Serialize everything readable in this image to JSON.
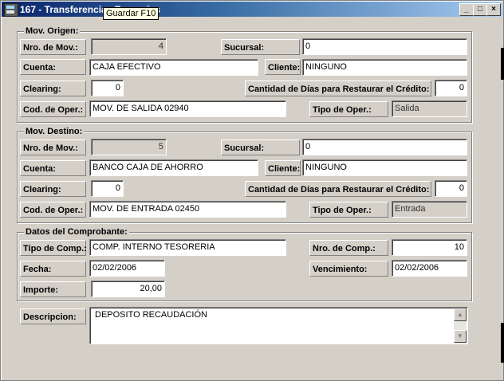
{
  "window": {
    "title": "167 - Transferencias Bancarias"
  },
  "tooltip": {
    "text": "Guardar F10"
  },
  "titlebar_buttons": {
    "minimize": "_",
    "maximize": "□",
    "close": "×"
  },
  "origen": {
    "legend": "Mov. Origen:",
    "nro_mov_label": "Nro. de Mov.:",
    "nro_mov": "4",
    "sucursal_label": "Sucursal:",
    "sucursal": "0",
    "cuenta_label": "Cuenta:",
    "cuenta": "CAJA EFECTIVO",
    "cliente_label": "Cliente:",
    "cliente": "NINGUNO",
    "clearing_label": "Clearing:",
    "clearing": "0",
    "dias_label": "Cantidad de Días para Restaurar el Crédito:",
    "dias": "0",
    "cod_oper_label": "Cod. de Oper.:",
    "cod_oper": "MOV. DE SALIDA   02940",
    "tipo_oper_label": "Tipo de Oper.:",
    "tipo_oper": "Salida"
  },
  "destino": {
    "legend": "Mov. Destino:",
    "nro_mov_label": "Nro. de Mov.:",
    "nro_mov": "5",
    "sucursal_label": "Sucursal:",
    "sucursal": "0",
    "cuenta_label": "Cuenta:",
    "cuenta": "BANCO CAJA DE AHORRO",
    "cliente_label": "Cliente:",
    "cliente": "NINGUNO",
    "clearing_label": "Clearing:",
    "clearing": "0",
    "dias_label": "Cantidad de Días para Restaurar el Crédito:",
    "dias": "0",
    "cod_oper_label": "Cod. de Oper.:",
    "cod_oper": "MOV. DE ENTRADA   02450",
    "tipo_oper_label": "Tipo de Oper.:",
    "tipo_oper": "Entrada"
  },
  "comprobante": {
    "legend": "Datos del Comprobante:",
    "tipo_comp_label": "Tipo de Comp.:",
    "tipo_comp": "COMP. INTERNO TESORERIA",
    "nro_comp_label": "Nro. de Comp.:",
    "nro_comp": "10",
    "fecha_label": "Fecha:",
    "fecha": "02/02/2006",
    "vencimiento_label": "Vencimiento:",
    "vencimiento": "02/02/2006",
    "importe_label": "Importe:",
    "importe": "20,00"
  },
  "descripcion": {
    "label": "Descripcion:",
    "value": "DEPOSITO RECAUDACIÓN"
  },
  "scrollbar": {
    "up": "▲",
    "down": "▼"
  }
}
